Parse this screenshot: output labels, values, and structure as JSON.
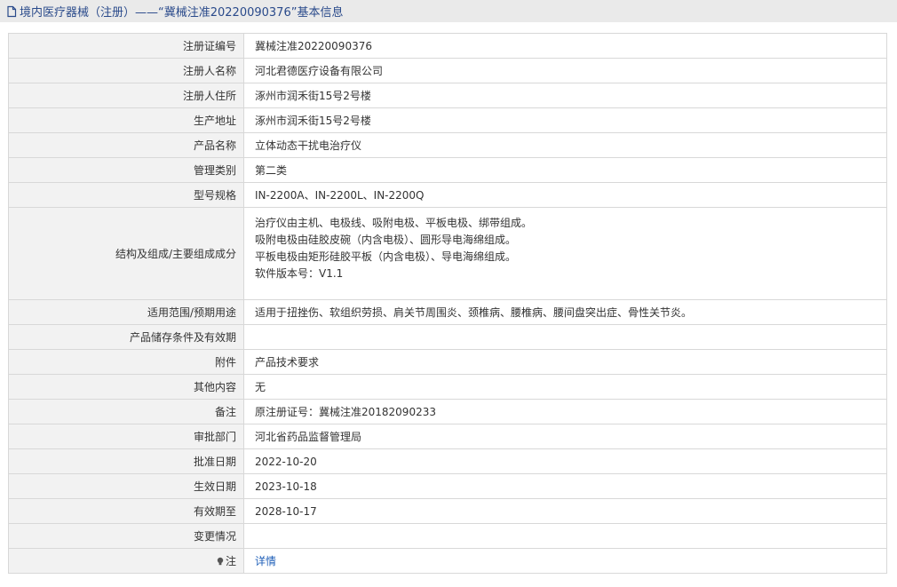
{
  "header": {
    "title": "境内医疗器械（注册）——“冀械注准20220090376”基本信息"
  },
  "rows": [
    {
      "label": "注册证编号",
      "value": "冀械注准20220090376"
    },
    {
      "label": "注册人名称",
      "value": "河北君德医疗设备有限公司"
    },
    {
      "label": "注册人住所",
      "value": "涿州市润禾街15号2号楼"
    },
    {
      "label": "生产地址",
      "value": "涿州市润禾街15号2号楼"
    },
    {
      "label": "产品名称",
      "value": "立体动态干扰电治疗仪"
    },
    {
      "label": "管理类别",
      "value": "第二类"
    },
    {
      "label": "型号规格",
      "value": "IN-2200A、IN-2200L、IN-2200Q"
    },
    {
      "label": "结构及组成/主要组成成分",
      "lines": [
        "治疗仪由主机、电极线、吸附电极、平板电极、绑带组成。",
        "吸附电极由硅胶皮碗（内含电极）、圆形导电海绵组成。",
        "平板电极由矩形硅胶平板（内含电极）、导电海绵组成。",
        "软件版本号：V1.1"
      ]
    },
    {
      "label": "适用范围/预期用途",
      "value": "适用于扭挫伤、软组织劳损、肩关节周围炎、颈椎病、腰椎病、腰间盘突出症、骨性关节炎。"
    },
    {
      "label": "产品储存条件及有效期",
      "value": ""
    },
    {
      "label": "附件",
      "value": "产品技术要求"
    },
    {
      "label": "其他内容",
      "value": "无"
    },
    {
      "label": "备注",
      "value": "原注册证号：冀械注准20182090233"
    },
    {
      "label": "审批部门",
      "value": "河北省药品监督管理局"
    },
    {
      "label": "批准日期",
      "value": "2022-10-20"
    },
    {
      "label": "生效日期",
      "value": "2023-10-18"
    },
    {
      "label": "有效期至",
      "value": "2028-10-17"
    },
    {
      "label": "变更情况",
      "value": ""
    },
    {
      "label": "注",
      "value": "详情"
    }
  ]
}
